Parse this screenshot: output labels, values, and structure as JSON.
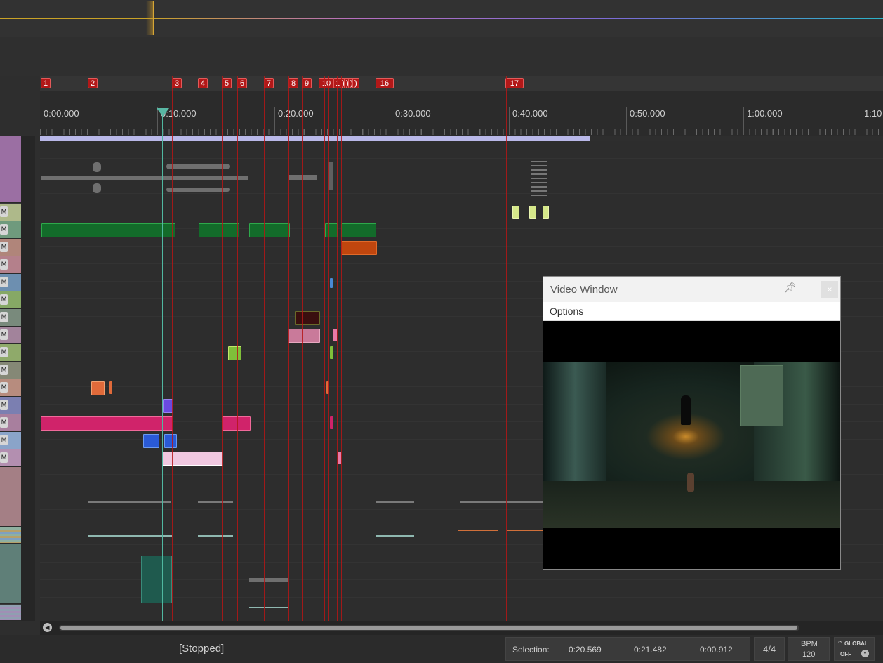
{
  "timeline": {
    "markers": [
      {
        "label": "1"
      },
      {
        "label": "2"
      },
      {
        "label": "3"
      },
      {
        "label": "4"
      },
      {
        "label": "5"
      },
      {
        "label": "6"
      },
      {
        "label": "7"
      },
      {
        "label": "8"
      },
      {
        "label": "9"
      },
      {
        "label": "10"
      },
      {
        "label": "1"
      },
      {
        "label": ")"
      },
      {
        "label": ")"
      },
      {
        "label": ")"
      },
      {
        "label": ")"
      },
      {
        "label": "16"
      },
      {
        "label": "17"
      }
    ],
    "ruler_labels": [
      "0:00.000",
      "0:10.000",
      "0:20.000",
      "0:30.000",
      "0:40.000",
      "0:50.000",
      "1:00.000",
      "1:10"
    ]
  },
  "tracks": {
    "mute_label": "M"
  },
  "status": {
    "transport_state": "[Stopped]",
    "selection_label": "Selection:",
    "selection_start": "0:20.569",
    "selection_end": "0:21.482",
    "selection_length": "0:00.912",
    "time_signature": "4/4",
    "bpm_label": "BPM",
    "bpm_value": "120",
    "global_label": "GLOBAL",
    "global_state": "OFF"
  },
  "video_window": {
    "title": "Video Window",
    "menu_options": "Options",
    "close_symbol": "×",
    "pin_icon": "pin-icon"
  },
  "colors": {
    "marker": "#b21818",
    "playhead": "#4fb8a0",
    "loop_bar": "#b9b8e8"
  }
}
